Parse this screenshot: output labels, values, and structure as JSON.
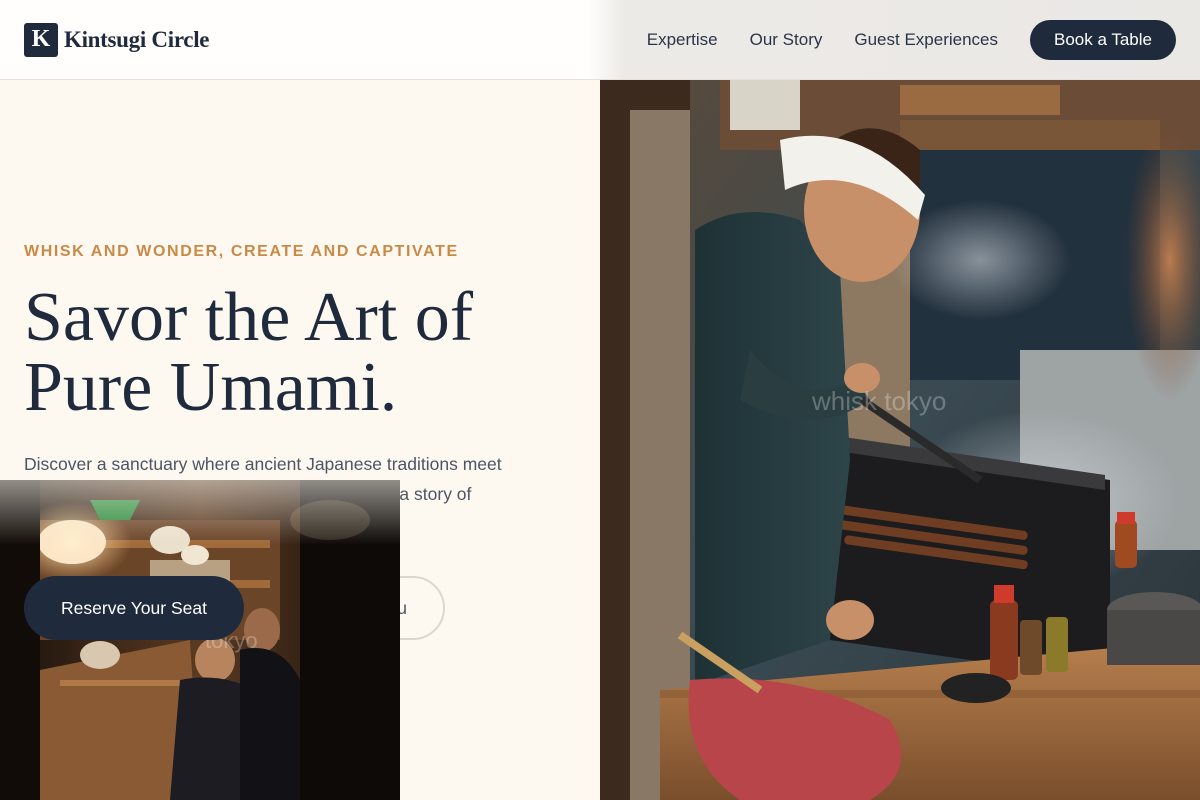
{
  "header": {
    "brand_mark": "K",
    "brand_name": "Kintsugi Circle",
    "nav": [
      "Expertise",
      "Our Story",
      "Guest Experiences"
    ],
    "cta": "Book a Table"
  },
  "hero": {
    "eyebrow": "Whisk and Wonder, Create and Captivate",
    "headline_line1": "Savor the Art of",
    "headline_line2": "Pure Umami.",
    "description": "Discover a sanctuary where ancient Japanese traditions meet contemporary culinary precision. Every bite tells a story of season, soul, and craftsmanship.",
    "primary_button": "Reserve Your Seat",
    "secondary_button": "Explore Menu"
  },
  "photos": {
    "main_watermark": "whisk tokyo",
    "secondary_watermark": "tokyo"
  },
  "colors": {
    "navy": "#1f2a3d",
    "accent": "#c98a47",
    "cream": "#fdf9f0"
  }
}
